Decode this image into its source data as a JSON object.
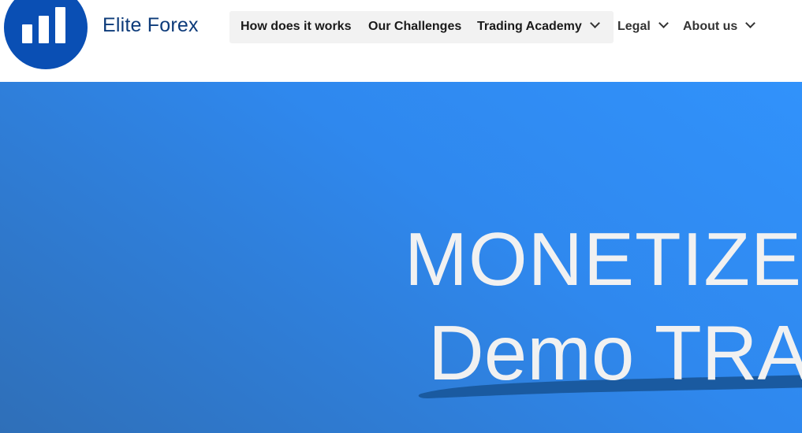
{
  "brand": {
    "name": "Elite Forex",
    "logo_icon": "bar-chart-icon",
    "logo_color": "#0a4fb4"
  },
  "nav": {
    "items": [
      {
        "label": "How does it works",
        "has_dropdown": false
      },
      {
        "label": "Our Challenges",
        "has_dropdown": false
      },
      {
        "label": "Trading Academy",
        "has_dropdown": true
      },
      {
        "label": "Legal",
        "has_dropdown": true
      },
      {
        "label": "About us",
        "has_dropdown": true
      }
    ]
  },
  "hero": {
    "line1": "MONETIZE",
    "line2": "Demo TRA",
    "gradient_colors": [
      "#3192fb",
      "#2f6fb8"
    ],
    "text_color": "#f1f1f1",
    "brush_color": "#1a5aa0"
  }
}
